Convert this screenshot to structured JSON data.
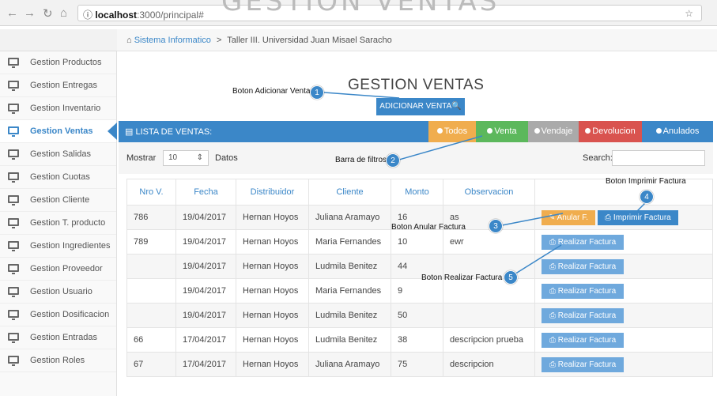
{
  "browser": {
    "overlay_title": "GESTION VENTAS",
    "url_host": "localhost",
    "url_rest": ":3000/principal#"
  },
  "breadcrumb": {
    "home_link": "Sistema Informatico",
    "separator": ">",
    "current": "Taller III. Universidad Juan Misael Saracho"
  },
  "sidebar": {
    "items": [
      {
        "label": "Gestion Productos"
      },
      {
        "label": "Gestion Entregas"
      },
      {
        "label": "Gestion Inventario"
      },
      {
        "label": "Gestion Ventas"
      },
      {
        "label": "Gestion Salidas"
      },
      {
        "label": "Gestion Cuotas"
      },
      {
        "label": "Gestion Cliente"
      },
      {
        "label": "Gestion T. producto"
      },
      {
        "label": "Gestion Ingredientes"
      },
      {
        "label": "Gestion Proveedor"
      },
      {
        "label": "Gestion Usuario"
      },
      {
        "label": "Gestion Dosificacion"
      },
      {
        "label": "Gestion Entradas"
      },
      {
        "label": "Gestion Roles"
      }
    ]
  },
  "main": {
    "title": "GESTION VENTAS",
    "add_button": "ADICIONAR VENTA",
    "list_label": "LISTA DE VENTAS:",
    "filters": [
      {
        "label": "Todos",
        "color": "#f0ad4e"
      },
      {
        "label": "Venta",
        "color": "#5cb85c"
      },
      {
        "label": "Vendaje",
        "color": "#aaaaaa"
      },
      {
        "label": "Devolucion",
        "color": "#d9534f"
      },
      {
        "label": "Anulados",
        "color": "#3b87c8"
      }
    ],
    "mostrar": "Mostrar",
    "show_value": "10",
    "datos": "Datos",
    "search_label": "Search:",
    "columns": [
      "Nro V.",
      "Fecha",
      "Distribuidor",
      "Cliente",
      "Monto",
      "Observacion",
      ""
    ],
    "rows": [
      {
        "nro": "786",
        "fecha": "19/04/2017",
        "dist": "Hernan Hoyos",
        "cliente": "Juliana Aramayo",
        "monto": "16",
        "obs": "as",
        "action": "anular-imprimir"
      },
      {
        "nro": "789",
        "fecha": "19/04/2017",
        "dist": "Hernan Hoyos",
        "cliente": "Maria Fernandes",
        "monto": "10",
        "obs": "ewr",
        "action": "realizar"
      },
      {
        "nro": "",
        "fecha": "19/04/2017",
        "dist": "Hernan Hoyos",
        "cliente": "Ludmila Benitez",
        "monto": "44",
        "obs": "",
        "action": "realizar"
      },
      {
        "nro": "",
        "fecha": "19/04/2017",
        "dist": "Hernan Hoyos",
        "cliente": "Maria Fernandes",
        "monto": "9",
        "obs": "",
        "action": "realizar"
      },
      {
        "nro": "",
        "fecha": "19/04/2017",
        "dist": "Hernan Hoyos",
        "cliente": "Ludmila Benitez",
        "monto": "50",
        "obs": "",
        "action": "realizar"
      },
      {
        "nro": "66",
        "fecha": "17/04/2017",
        "dist": "Hernan Hoyos",
        "cliente": "Ludmila Benitez",
        "monto": "38",
        "obs": "descripcion prueba",
        "action": "realizar"
      },
      {
        "nro": "67",
        "fecha": "17/04/2017",
        "dist": "Hernan Hoyos",
        "cliente": "Juliana Aramayo",
        "monto": "75",
        "obs": "descripcion",
        "action": "realizar"
      }
    ],
    "btn_anular": "Anular F.",
    "btn_imprimir": "Imprimir Factura",
    "btn_realizar": "Realizar Factura"
  },
  "annotations": [
    {
      "num": "1",
      "text": "Boton Adicionar Venta"
    },
    {
      "num": "2",
      "text": "Barra de filtros"
    },
    {
      "num": "3",
      "text": "Boton Anular Factura"
    },
    {
      "num": "4",
      "text": "Boton Imprimir Factura"
    },
    {
      "num": "5",
      "text": "Boton Realizar Factura"
    }
  ]
}
